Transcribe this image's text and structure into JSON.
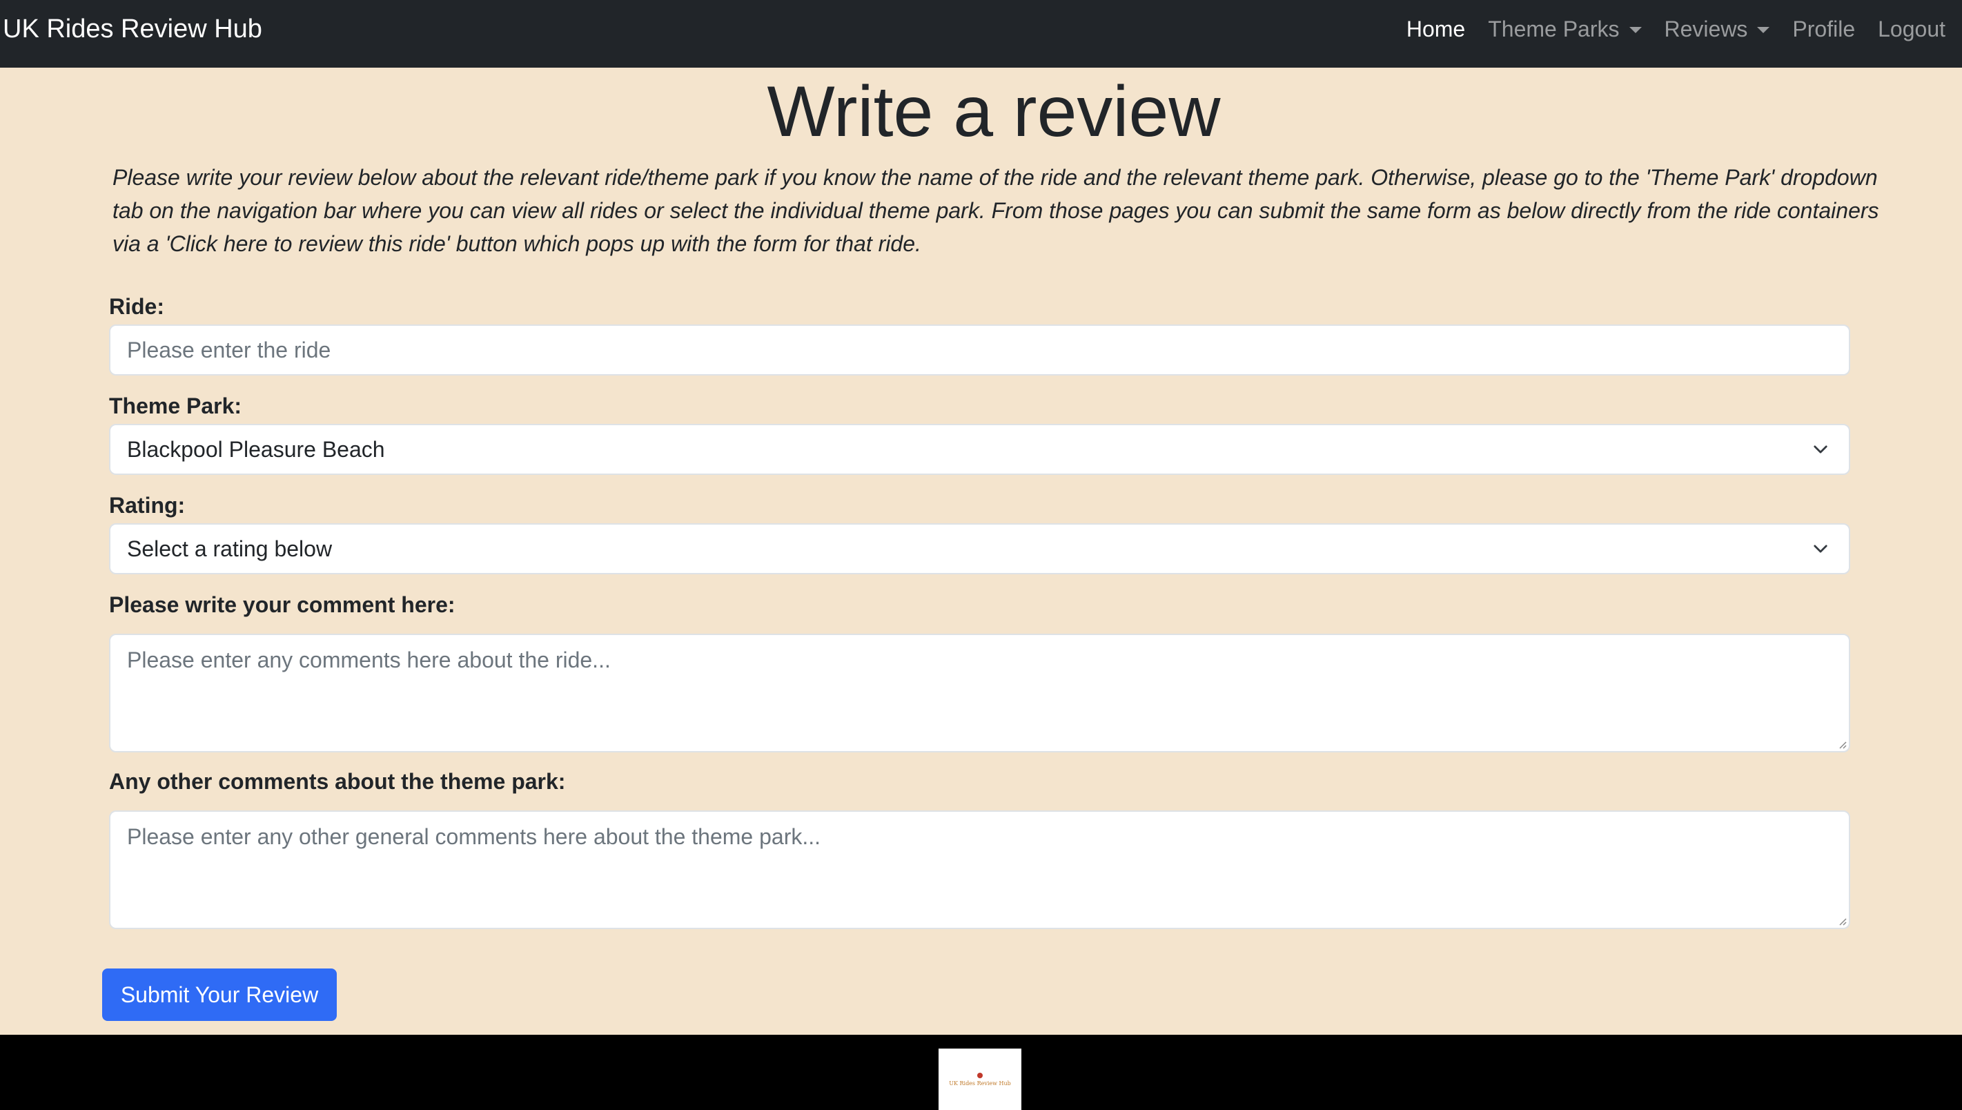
{
  "nav": {
    "brand": "UK Rides Review Hub",
    "items": [
      {
        "label": "Home",
        "active": true,
        "dropdown": false
      },
      {
        "label": "Theme Parks",
        "active": false,
        "dropdown": true
      },
      {
        "label": "Reviews",
        "active": false,
        "dropdown": true
      },
      {
        "label": "Profile",
        "active": false,
        "dropdown": false
      },
      {
        "label": "Logout",
        "active": false,
        "dropdown": false
      }
    ]
  },
  "page": {
    "title": "Write a review",
    "intro": "Please write your review below about the relevant ride/theme park if you know the name of the ride and the relevant theme park. Otherwise, please go to the 'Theme Park' dropdown tab on the navigation bar where you can view all rides or select the individual theme park. From those pages you can submit the same form as below directly from the ride containers via a 'Click here to review this ride' button which pops up with the form for that ride."
  },
  "form": {
    "ride": {
      "label": "Ride:",
      "placeholder": "Please enter the ride",
      "value": ""
    },
    "theme_park": {
      "label": "Theme Park:",
      "selected": "Blackpool Pleasure Beach"
    },
    "rating": {
      "label": "Rating:",
      "selected": "Select a rating below"
    },
    "comment": {
      "label": "Please write your comment here:",
      "placeholder": "Please enter any comments here about the ride..."
    },
    "park_comment": {
      "label": "Any other comments about the theme park:",
      "placeholder": "Please enter any other general comments here about the theme park..."
    },
    "submit_label": "Submit Your Review"
  },
  "footer": {
    "logo_text": "UK Rides Review Hub"
  },
  "colors": {
    "page_background": "#f4e4cd",
    "navbar": "#212529",
    "primary_button": "#2f6bf5",
    "footer": "#000000"
  }
}
